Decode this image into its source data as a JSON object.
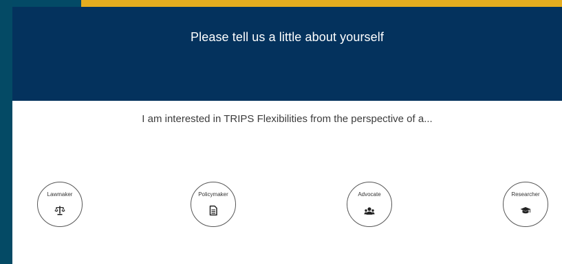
{
  "colors": {
    "background": "#034a66",
    "accent_strip": "#e5ad1f",
    "header": "#04325d",
    "panel": "#ffffff"
  },
  "modal": {
    "title": "Please tell us a little about yourself",
    "subtitle": "I am interested in TRIPS Flexibilities from the perspective of a..."
  },
  "options": [
    {
      "label": "Lawmaker",
      "icon": "scales-icon"
    },
    {
      "label": "Policymaker",
      "icon": "document-icon"
    },
    {
      "label": "Advocate",
      "icon": "users-icon"
    },
    {
      "label": "Researcher",
      "icon": "graduation-cap-icon"
    }
  ]
}
